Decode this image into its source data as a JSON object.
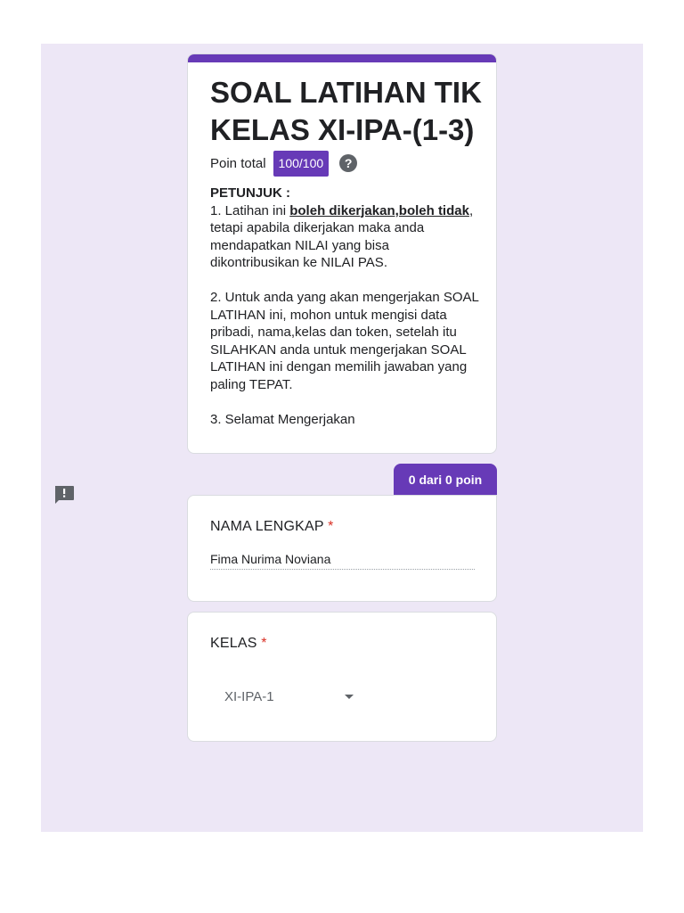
{
  "form": {
    "title": "SOAL LATIHAN TIK KELAS XI-IPA-(1-3)",
    "points_label": "Poin total",
    "points_value": "100/100",
    "help_icon": "?",
    "instructions": {
      "heading": "PETUNJUK :",
      "p1_prefix": "1. Latihan ini ",
      "p1_emphasis": "boleh dikerjakan,boleh tidak",
      "p1_suffix": ", tetapi apabila dikerjakan maka anda mendapatkan NILAI yang bisa dikontribusikan ke NILAI PAS.",
      "p2": "2. Untuk anda yang akan mengerjakan SOAL LATIHAN ini, mohon untuk mengisi data pribadi, nama,kelas dan token, setelah itu SILAHKAN anda untuk mengerjakan SOAL LATIHAN ini dengan memilih jawaban yang paling TEPAT.",
      "p3": "3. Selamat Mengerjakan"
    }
  },
  "section_score": "0 dari 0 poin",
  "questions": [
    {
      "title": "NAMA LENGKAP",
      "required_mark": "*",
      "answer": "Fima Nurima Noviana"
    },
    {
      "title": "KELAS",
      "required_mark": "*",
      "selected": "XI-IPA-1"
    }
  ],
  "colors": {
    "accent": "#673ab7",
    "background": "#ede7f6",
    "required": "#d93025"
  },
  "icons": {
    "feedback": "feedback-icon",
    "help": "help-icon",
    "dropdown": "chevron-down-icon"
  }
}
